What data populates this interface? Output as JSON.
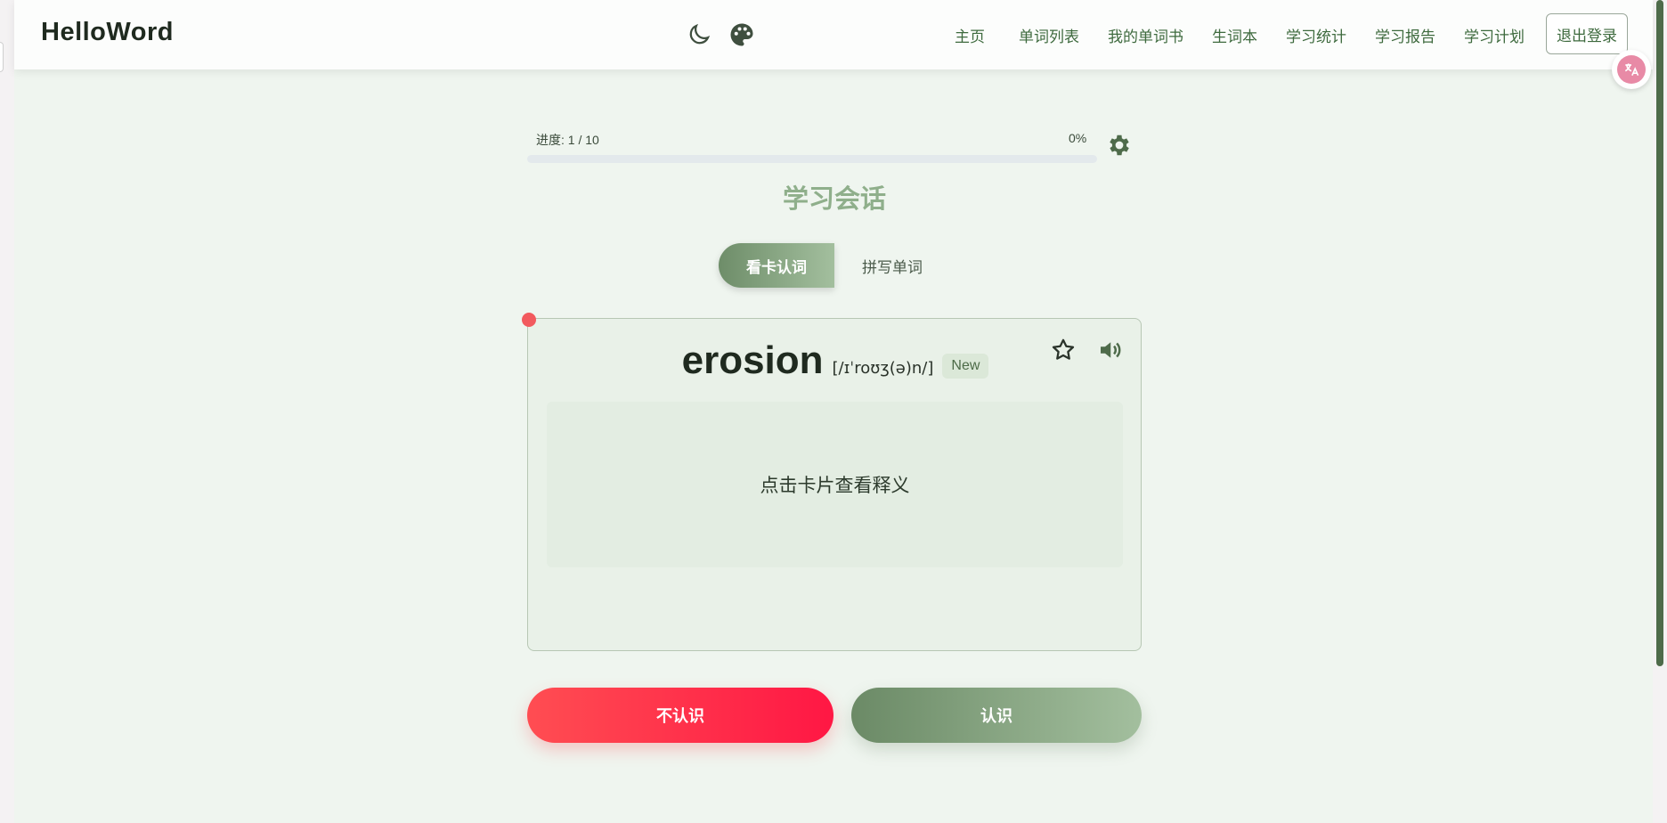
{
  "app": {
    "brand": "HelloWord"
  },
  "nav": {
    "items": [
      {
        "label": "主页"
      },
      {
        "label": "单词列表"
      },
      {
        "label": "我的单词书"
      },
      {
        "label": "生词本"
      },
      {
        "label": "学习统计"
      },
      {
        "label": "学习报告"
      },
      {
        "label": "学习计划"
      }
    ],
    "logout_label": "退出登录",
    "icons": [
      "moon-icon",
      "palette-icon"
    ]
  },
  "progress": {
    "label": "进度: 1 / 10",
    "percent_label": "0%",
    "fraction": 0
  },
  "session": {
    "title": "学习会话"
  },
  "modes": {
    "active": "看卡认词",
    "inactive": "拼写单词"
  },
  "card": {
    "word": "erosion",
    "phonetic": "[/ɪˈroʊʒ(ə)n/]",
    "badge": "New",
    "hint": "点击卡片查看释义",
    "icons": [
      "star-icon",
      "speaker-icon"
    ]
  },
  "actions": {
    "unknown": "不认识",
    "known": "认识"
  },
  "colors": {
    "accent": "#6e8d69",
    "danger": "#ff1744",
    "text_green": "#3e6a3e"
  }
}
